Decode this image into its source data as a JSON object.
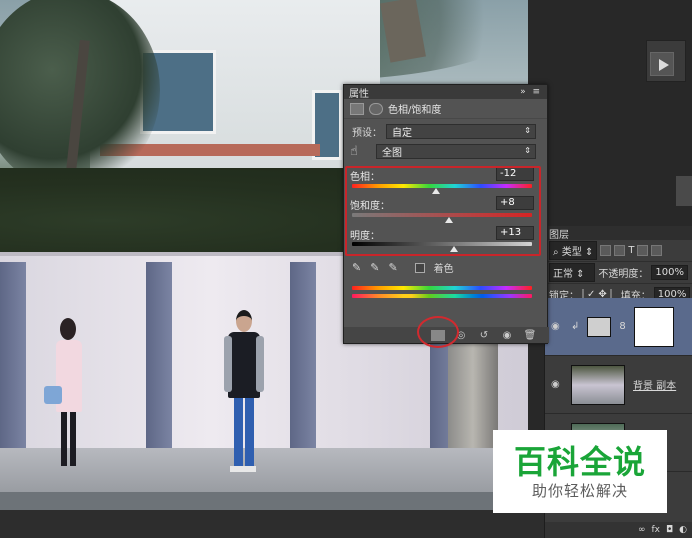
{
  "properties_panel": {
    "tab_title": "属性",
    "adjustment_title": "色相/饱和度",
    "preset_label": "预设：",
    "preset_value": "自定",
    "channel_value": "全图",
    "hue": {
      "label": "色相：",
      "value": "-12",
      "level": -12
    },
    "saturation": {
      "label": "饱和度：",
      "value": "+8",
      "level": 8
    },
    "lightness": {
      "label": "明度：",
      "value": "+13",
      "level": 13
    },
    "colorize_label": "着色"
  },
  "layers_panel": {
    "tab_title": "图层",
    "filter_kind": "类型",
    "blend_mode": "正常",
    "opacity_label": "不透明度：",
    "opacity_value": "100%",
    "lock_label": "锁定：",
    "fill_label": "填充：",
    "fill_value": "100%",
    "layers": [
      {
        "name": ""
      },
      {
        "name": "背景 副本"
      },
      {
        "name": ""
      }
    ]
  },
  "watermark": {
    "title": "百科全说",
    "subtitle": "助你轻松解决"
  },
  "colors": {
    "highlight": "#c9252a",
    "watermark_green": "#1aa538"
  }
}
